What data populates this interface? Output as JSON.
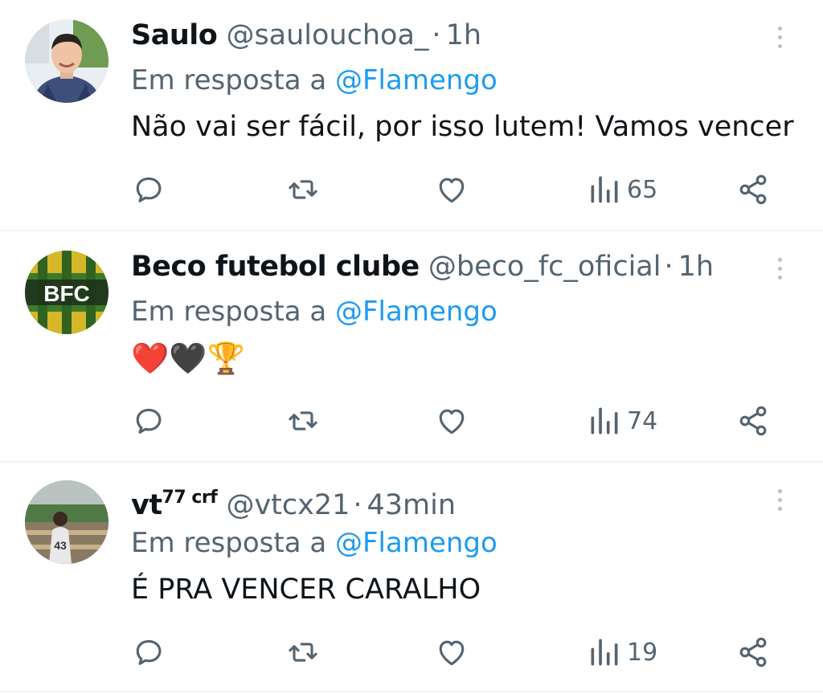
{
  "reply_prefix": "Em resposta a",
  "tweets": [
    {
      "name": "Saulo",
      "name_sup": "",
      "handle": "@saulouchoa_",
      "time": "1h",
      "mention": "@Flamengo",
      "text": "Não vai ser fácil, por isso lutem! Vamos vencer",
      "views": "65",
      "avatar_text": ""
    },
    {
      "name": "Beco futebol clube",
      "name_sup": "",
      "handle": "@beco_fc_oficial",
      "time": "1h",
      "mention": "@Flamengo",
      "text": "❤️🖤🏆",
      "views": "74",
      "avatar_text": "BFC"
    },
    {
      "name": "vt",
      "name_sup": "77 crf",
      "handle": "@vtcx21",
      "time": "43min",
      "mention": "@Flamengo",
      "text": "É PRA VENCER CARALHO",
      "views": "19",
      "avatar_text": "43"
    }
  ],
  "icons": {
    "reply": "reply-bubble-icon",
    "retweet": "retweet-icon",
    "like": "heart-icon",
    "views": "views-bars-icon",
    "share": "share-icon",
    "more": "more-vertical-icon"
  },
  "colors": {
    "text": "#0f1419",
    "secondary": "#536471",
    "mention": "#1d9bf0",
    "divider": "#eff3f4"
  }
}
